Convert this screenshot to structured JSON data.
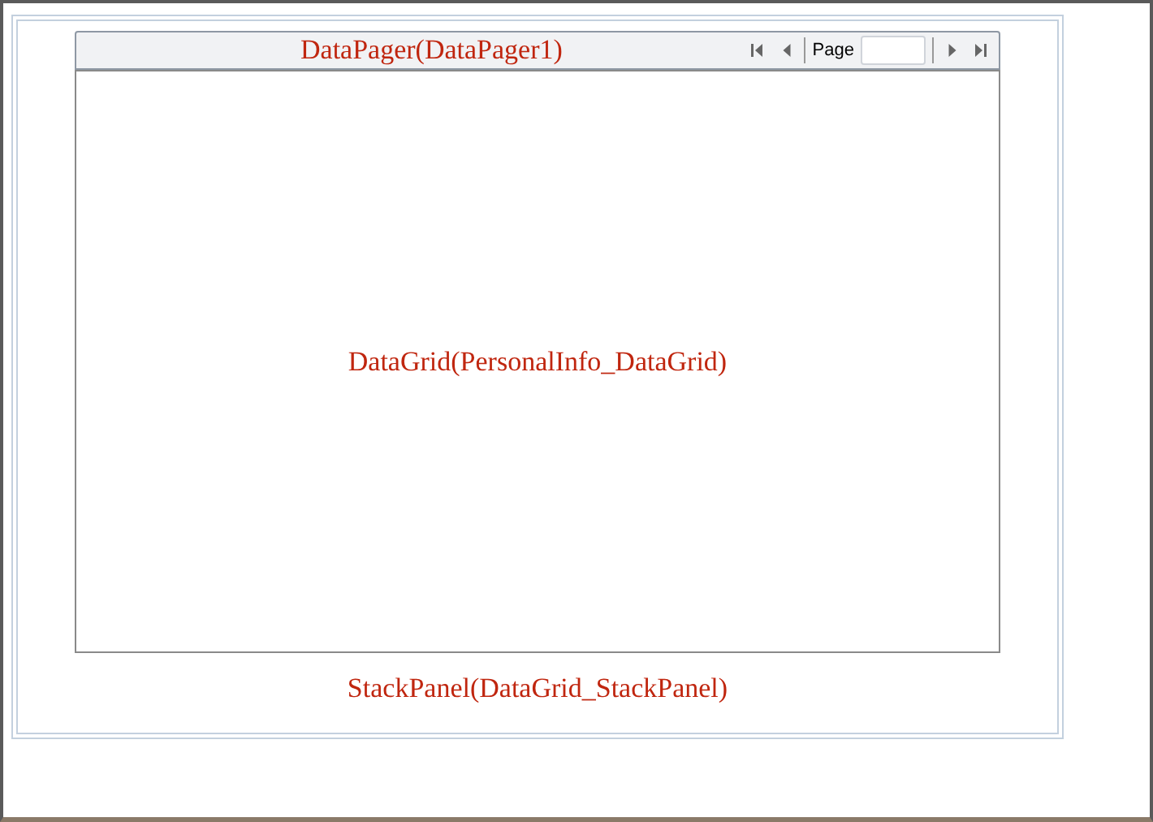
{
  "pager": {
    "label": "DataPager(DataPager1)",
    "page_label": "Page"
  },
  "grid": {
    "label": "DataGrid(PersonalInfo_DataGrid)"
  },
  "stack_panel": {
    "label": "StackPanel(DataGrid_StackPanel)"
  }
}
